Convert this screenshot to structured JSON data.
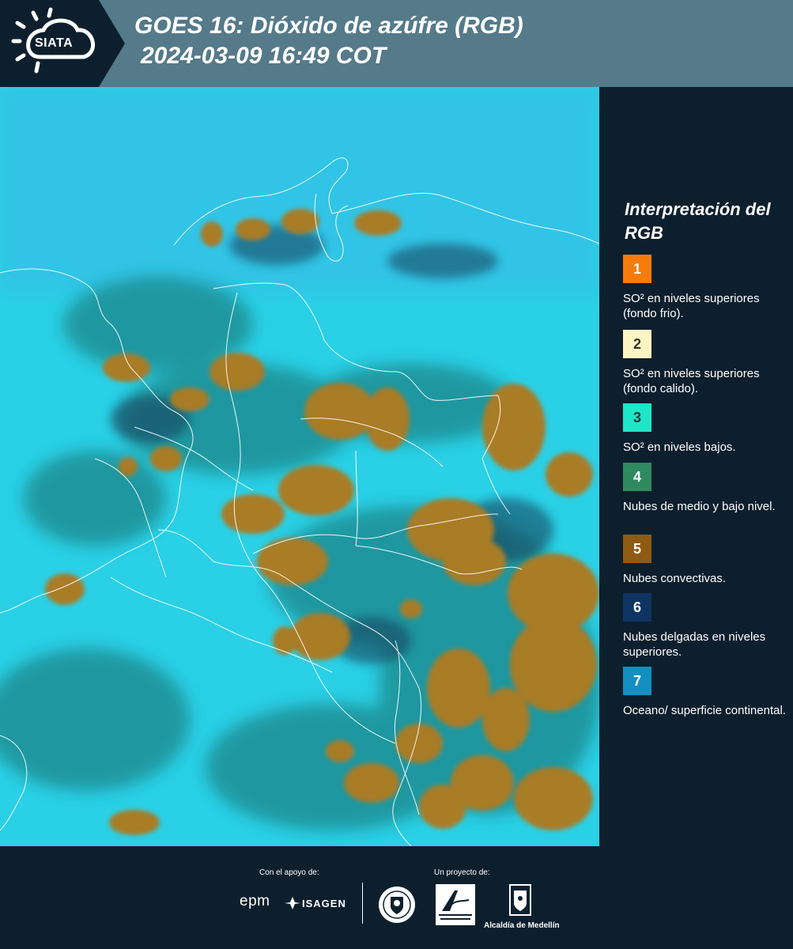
{
  "header": {
    "logo_text": "SIATA",
    "title_line1": "GOES 16: Dióxido de azúfre (RGB)",
    "title_line2": "2024-03-09 16:49 COT"
  },
  "legend": {
    "title": "Interpretación del RGB",
    "items": [
      {
        "number": "1",
        "color": "#f57c0c",
        "number_color": "#ffffff",
        "label": "SO² en niveles superiores (fondo frio)."
      },
      {
        "number": "2",
        "color": "#fdf4c2",
        "number_color": "#333333",
        "label": "SO² en niveles superiores (fondo calido)."
      },
      {
        "number": "3",
        "color": "#1ee6c6",
        "number_color": "#333333",
        "label": "SO² en niveles bajos."
      },
      {
        "number": "4",
        "color": "#2f8a5f",
        "number_color": "#ffffff",
        "label": "Nubes de medio y bajo nivel."
      },
      {
        "number": "5",
        "color": "#8f5a13",
        "number_color": "#ffffff",
        "label": "Nubes convectivas."
      },
      {
        "number": "6",
        "color": "#0e3464",
        "number_color": "#ffffff",
        "label": "Nubes delgadas en niveles superiores."
      },
      {
        "number": "7",
        "color": "#138fc0",
        "number_color": "#ffffff",
        "label": "Oceano/ superficie continental."
      }
    ]
  },
  "footer": {
    "support_label": "Con el apoyo de:",
    "project_label": "Un proyecto de:",
    "sponsor_epm": "epm",
    "sponsor_isagen": "ISAGEN",
    "partner_area": "Área Metropolitana Valle de Aburrá",
    "partner_alcaldia": "Alcaldía de Medellín"
  },
  "colors": {
    "header_bg": "#557a8a",
    "panel_bg": "#0d1f2d",
    "map_cyan": "#2ad0e6",
    "cloud_brown": "#a97b25"
  }
}
